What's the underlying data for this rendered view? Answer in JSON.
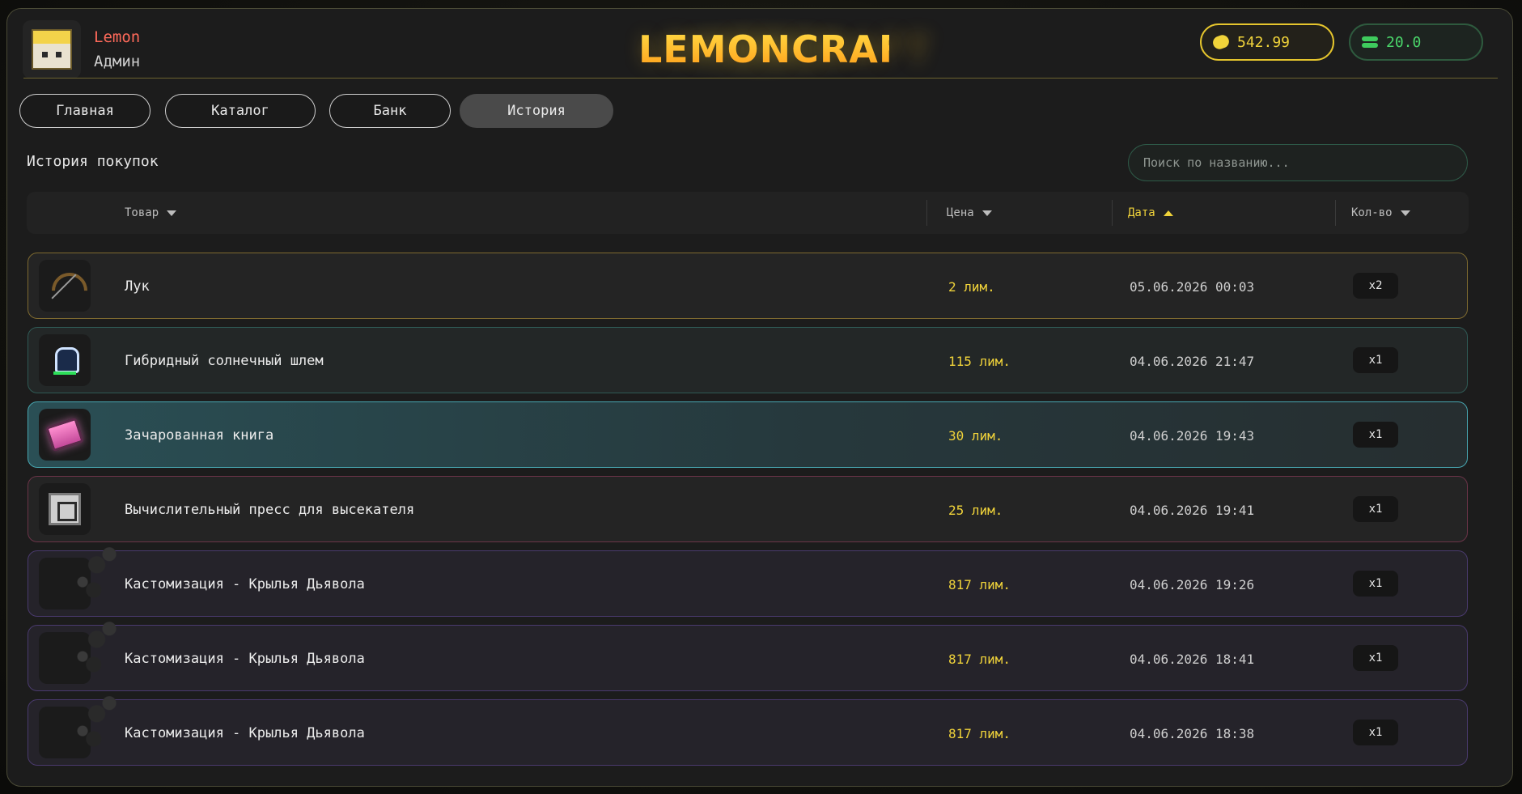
{
  "user": {
    "name": "Lemon",
    "role": "Админ"
  },
  "brand": {
    "logo_text": "LEMONCRAFT",
    "color_top": "#ffe14a",
    "color_bottom": "#ff9a1a"
  },
  "balances": {
    "gold": "542.99",
    "cash": "20.0",
    "gold_icon": "lemon-coin-icon",
    "cash_icon": "coin-stack-icon"
  },
  "nav": {
    "tabs": [
      {
        "label": "Главная"
      },
      {
        "label": "Каталог"
      },
      {
        "label": "Банк"
      },
      {
        "label": "История",
        "active": true
      }
    ]
  },
  "section": {
    "title": "История покупок"
  },
  "search": {
    "placeholder": "Поиск по названию..."
  },
  "table": {
    "headers": [
      {
        "label": "Товар",
        "sort": "desc"
      },
      {
        "label": "Цена",
        "sort": "desc"
      },
      {
        "label": "Дата",
        "sort": "asc",
        "active": true
      },
      {
        "label": "Кол-во",
        "sort": "desc"
      }
    ],
    "rows": [
      {
        "name": "Лук",
        "price": "2 лим.",
        "date": "05.06.2026 00:03",
        "qty": "x2",
        "icon": "bow-icon",
        "accent": "#7e6a30"
      },
      {
        "name": "Гибридный солнечный шлем",
        "price": "115 лим.",
        "date": "04.06.2026 21:47",
        "qty": "x1",
        "icon": "helmet-icon",
        "accent": "#2f5a55"
      },
      {
        "name": "Зачарованная книга",
        "price": "30 лим.",
        "date": "04.06.2026 19:43",
        "qty": "x1",
        "icon": "enchanted-book-icon",
        "accent": "#47a6b0"
      },
      {
        "name": "Вычислительный пресс для высекателя",
        "price": "25 лим.",
        "date": "04.06.2026 19:41",
        "qty": "x1",
        "icon": "press-icon",
        "accent": "#6b3448"
      },
      {
        "name": "Кастомизация - Крылья Дьявола",
        "price": "817 лим.",
        "date": "04.06.2026 19:26",
        "qty": "x1",
        "icon": "devil-wings-icon",
        "accent": "#4a3a6e"
      },
      {
        "name": "Кастомизация - Крылья Дьявола",
        "price": "817 лим.",
        "date": "04.06.2026 18:41",
        "qty": "x1",
        "icon": "devil-wings-icon",
        "accent": "#4a3a6e"
      },
      {
        "name": "Кастомизация - Крылья Дьявола",
        "price": "817 лим.",
        "date": "04.06.2026 18:38",
        "qty": "x1",
        "icon": "devil-wings-icon",
        "accent": "#4a3a6e"
      }
    ]
  }
}
